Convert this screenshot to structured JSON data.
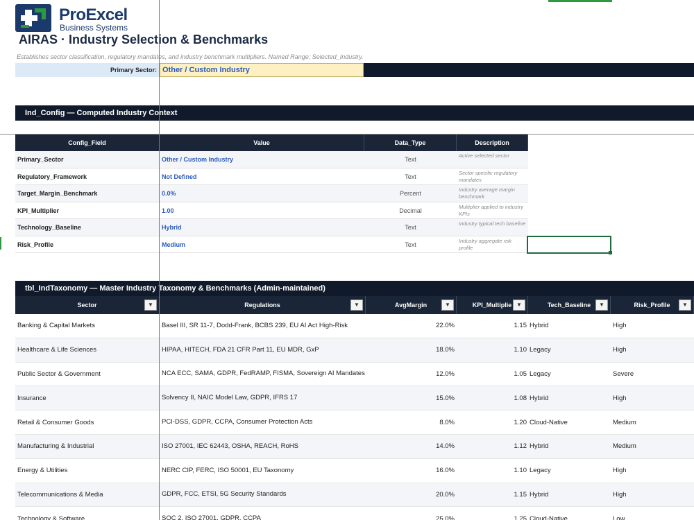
{
  "brand": {
    "name": "ProExcel",
    "tagline": "Business Systems",
    "colors": {
      "navy": "#1b3a6b",
      "green": "#2e9a3f",
      "header_dark": "#1a2638"
    }
  },
  "page": {
    "title": "AIRAS · Industry Selection & Benchmarks",
    "subtitle": "Establishes sector classification, regulatory mandates, and industry benchmark multipliers. Named Range: Selected_Industry."
  },
  "primary_sector": {
    "label": "Primary Sector:",
    "value": "Other / Custom Industry"
  },
  "config_section": {
    "title": "Ind_Config — Computed Industry Context",
    "headers": [
      "Config_Field",
      "Value",
      "Data_Type",
      "Description"
    ],
    "rows": [
      {
        "field": "Primary_Sector",
        "value": "Other / Custom Industry",
        "type": "Text",
        "desc": "Active selected sector"
      },
      {
        "field": "Regulatory_Framework",
        "value": "Not Defined",
        "type": "Text",
        "desc": "Sector specific regulatory mandates"
      },
      {
        "field": "Target_Margin_Benchmark",
        "value": "0.0%",
        "type": "Percent",
        "desc": "Industry average margin benchmark"
      },
      {
        "field": "KPI_Multiplier",
        "value": "1.00",
        "type": "Decimal",
        "desc": "Multiplier applied to industry KPIs"
      },
      {
        "field": "Technology_Baseline",
        "value": "Hybrid",
        "type": "Text",
        "desc": "Industry typical tech baseline"
      },
      {
        "field": "Risk_Profile",
        "value": "Medium",
        "type": "Text",
        "desc": "Industry aggregate risk profile"
      }
    ]
  },
  "taxonomy_section": {
    "title": "tbl_IndTaxonomy — Master Industry Taxonomy & Benchmarks (Admin-maintained)",
    "headers": [
      "Sector",
      "Regulations",
      "AvgMargin",
      "KPI_Multiplie",
      "Tech_Baseline",
      "Risk_Profile"
    ],
    "filter_icon": "dropdown-arrow-icon",
    "rows": [
      {
        "sector": "Banking & Capital Markets",
        "regs": "Basel III, SR 11-7, Dodd-Frank, BCBS 239, EU AI Act High-Risk",
        "margin": "22.0%",
        "kpi": "1.15",
        "tech": "Hybrid",
        "risk": "High"
      },
      {
        "sector": "Healthcare & Life Sciences",
        "regs": "HIPAA, HITECH, FDA 21 CFR Part 11, EU MDR, GxP",
        "margin": "18.0%",
        "kpi": "1.10",
        "tech": "Legacy",
        "risk": "High"
      },
      {
        "sector": "Public Sector & Government",
        "regs": "NCA ECC, SAMA, GDPR, FedRAMP, FISMA, Sovereign AI Mandates",
        "margin": "12.0%",
        "kpi": "1.05",
        "tech": "Legacy",
        "risk": "Severe"
      },
      {
        "sector": "Insurance",
        "regs": "Solvency II, NAIC Model Law, GDPR, IFRS 17",
        "margin": "15.0%",
        "kpi": "1.08",
        "tech": "Hybrid",
        "risk": "High"
      },
      {
        "sector": "Retail & Consumer Goods",
        "regs": "PCI-DSS, GDPR, CCPA, Consumer Protection Acts",
        "margin": "8.0%",
        "kpi": "1.20",
        "tech": "Cloud-Native",
        "risk": "Medium"
      },
      {
        "sector": "Manufacturing & Industrial",
        "regs": "ISO 27001, IEC 62443, OSHA, REACH, RoHS",
        "margin": "14.0%",
        "kpi": "1.12",
        "tech": "Hybrid",
        "risk": "Medium"
      },
      {
        "sector": "Energy & Utilities",
        "regs": "NERC CIP, FERC, ISO 50001, EU Taxonomy",
        "margin": "16.0%",
        "kpi": "1.10",
        "tech": "Legacy",
        "risk": "High"
      },
      {
        "sector": "Telecommunications & Media",
        "regs": "GDPR, FCC, ETSI, 5G Security Standards",
        "margin": "20.0%",
        "kpi": "1.15",
        "tech": "Hybrid",
        "risk": "High"
      },
      {
        "sector": "Technology & Software",
        "regs": "SOC 2, ISO 27001, GDPR, CCPA",
        "margin": "25.0%",
        "kpi": "1.25",
        "tech": "Cloud-Native",
        "risk": "Low"
      }
    ]
  }
}
